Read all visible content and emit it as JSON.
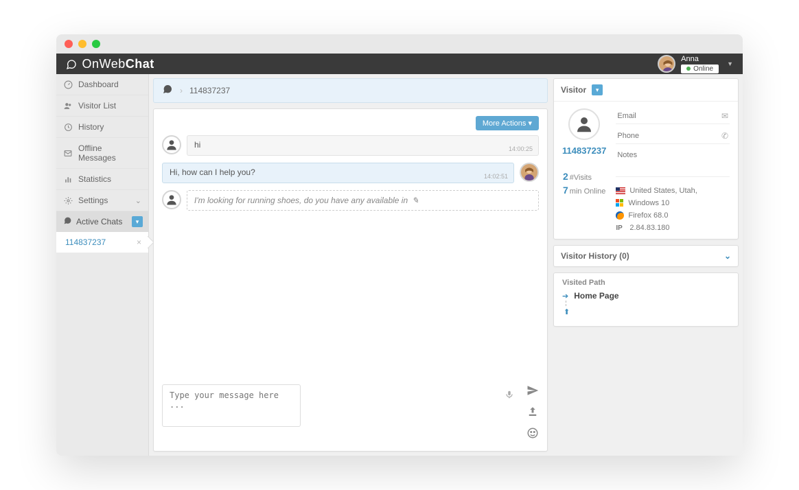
{
  "brand": {
    "thin": "OnWeb",
    "bold": "Chat"
  },
  "user": {
    "name": "Anna",
    "status": "Online"
  },
  "sidebar": {
    "items": [
      {
        "icon": "dashboard",
        "label": "Dashboard"
      },
      {
        "icon": "users",
        "label": "Visitor List"
      },
      {
        "icon": "history",
        "label": "History"
      },
      {
        "icon": "mail",
        "label": "Offline Messages"
      },
      {
        "icon": "stats",
        "label": "Statistics"
      },
      {
        "icon": "gear",
        "label": "Settings",
        "caret": true
      }
    ],
    "active_section": "Active Chats",
    "active_chat": "114837237"
  },
  "breadcrumb": {
    "sep": "›",
    "id": "114837237"
  },
  "chat": {
    "more_actions": "More Actions",
    "messages": [
      {
        "role": "visitor",
        "text": "hi",
        "time": "14:00:25"
      },
      {
        "role": "agent",
        "text": "Hi, how can I help you?",
        "time": "14:02:51"
      },
      {
        "role": "typing",
        "text": "I'm looking for running shoes, do you have any available in"
      }
    ],
    "input_placeholder": "Type your message here ..."
  },
  "visitor": {
    "title": "Visitor",
    "id": "114837237",
    "fields": {
      "email_ph": "Email",
      "phone_ph": "Phone",
      "notes_ph": "Notes"
    },
    "stats": {
      "visits_n": "2",
      "visits_lbl": "#Visits",
      "online_n": "7",
      "online_unit": "min",
      "online_lbl": "Online"
    },
    "meta": {
      "location": "United States, Utah,",
      "os": "Windows 10",
      "browser": "Firefox 68.0",
      "ip": "2.84.83.180"
    },
    "history_label": "Visitor History (0)",
    "path_label": "Visited Path",
    "path_page": "Home Page"
  }
}
